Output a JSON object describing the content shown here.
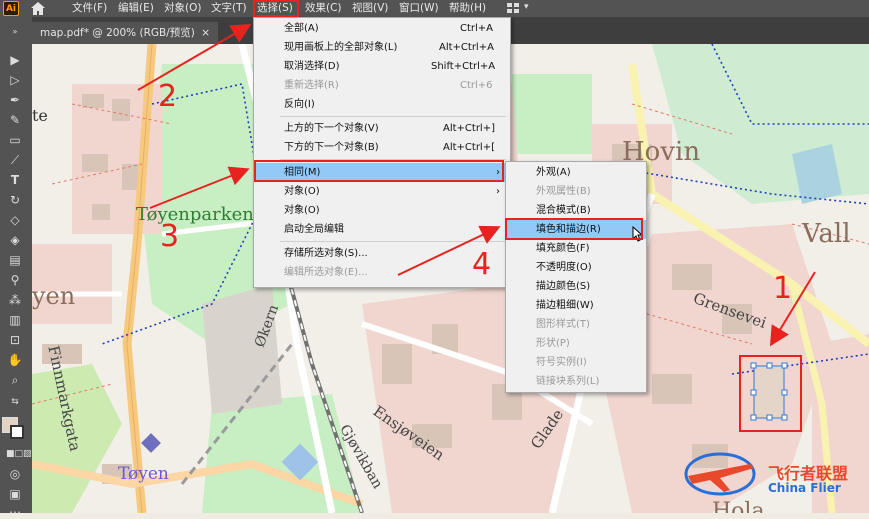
{
  "app": {
    "logo": "Ai",
    "home_icon": "home-icon"
  },
  "menubar": {
    "items": [
      "文件(F)",
      "编辑(E)",
      "对象(O)",
      "文字(T)",
      "选择(S)",
      "效果(C)",
      "视图(V)",
      "窗口(W)",
      "帮助(H)"
    ],
    "workspace_icon": "grid-icon"
  },
  "document": {
    "tab_title": "map.pdf* @ 200% (RGB/预览)",
    "close": "×"
  },
  "select_menu": {
    "items": [
      {
        "label": "全部(A)",
        "shortcut": "Ctrl+A",
        "disabled": false
      },
      {
        "label": "现用画板上的全部对象(L)",
        "shortcut": "Alt+Ctrl+A",
        "disabled": false
      },
      {
        "label": "取消选择(D)",
        "shortcut": "Shift+Ctrl+A",
        "disabled": false
      },
      {
        "label": "重新选择(R)",
        "shortcut": "Ctrl+6",
        "disabled": true
      },
      {
        "label": "反向(I)",
        "shortcut": "",
        "disabled": false
      },
      {
        "label": "上方的下一个对象(V)",
        "shortcut": "Alt+Ctrl+]",
        "disabled": false
      },
      {
        "label": "下方的下一个对象(B)",
        "shortcut": "Alt+Ctrl+[",
        "disabled": false
      },
      {
        "label": "相同(M)",
        "shortcut": "",
        "disabled": false,
        "submenu": true
      },
      {
        "label": "对象(O)",
        "shortcut": "",
        "disabled": false,
        "submenu": true
      },
      {
        "label": "对象(O)",
        "shortcut": "",
        "disabled": false
      },
      {
        "label": "启动全局编辑",
        "shortcut": "",
        "disabled": false
      },
      {
        "label": "存储所选对象(S)...",
        "shortcut": "",
        "disabled": false
      },
      {
        "label": "编辑所选对象(E)...",
        "shortcut": "",
        "disabled": true
      }
    ]
  },
  "same_submenu": {
    "items": [
      {
        "label": "外观(A)",
        "disabled": false
      },
      {
        "label": "外观属性(B)",
        "disabled": true
      },
      {
        "label": "混合模式(B)",
        "disabled": false
      },
      {
        "label": "填色和描边(R)",
        "disabled": false
      },
      {
        "label": "填充颜色(F)",
        "disabled": false
      },
      {
        "label": "不透明度(O)",
        "disabled": false
      },
      {
        "label": "描边颜色(S)",
        "disabled": false
      },
      {
        "label": "描边粗细(W)",
        "disabled": false
      },
      {
        "label": "图形样式(T)",
        "disabled": true
      },
      {
        "label": "形状(P)",
        "disabled": true
      },
      {
        "label": "符号实例(I)",
        "disabled": true
      },
      {
        "label": "链接块系列(L)",
        "disabled": true
      }
    ]
  },
  "map_labels": {
    "hovin": "Hovin",
    "toyenparken": "Tøyenparken",
    "vall": "Vall",
    "yen": "yen",
    "finnmarkgata": "Finnmarkgata",
    "okern": "Økern",
    "grensevei": "Grensevei",
    "ensjoveien": "Ensjøveien",
    "glade": "Glade",
    "toyen": "Tøyen",
    "gjovikbanen": "Gjøvikban",
    "te": "te",
    "hola": "Hola"
  },
  "annotations": {
    "steps": [
      "1",
      "2",
      "3",
      "4"
    ]
  },
  "watermark": {
    "name": "飞行者联盟",
    "sub": "China Flier"
  },
  "colors": {
    "highlight": "#91c9f7",
    "annotation_red": "#e8231f",
    "selection_blue": "#2e7bd6"
  }
}
